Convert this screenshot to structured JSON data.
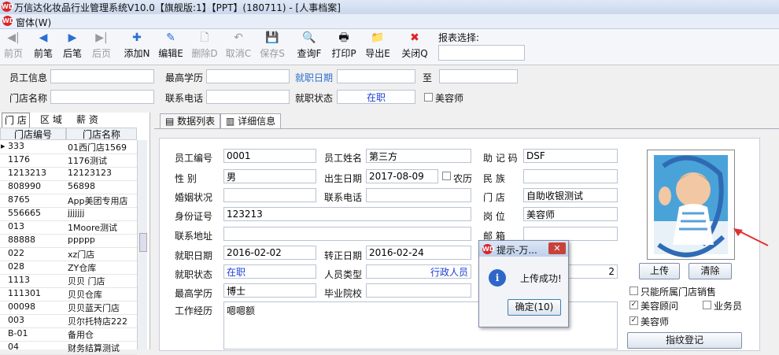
{
  "window": {
    "title": "万信达化妆品行业管理系统V10.0【旗舰版:1】【PPT】(180711) - [人事档案]",
    "menu": "窗体(W)"
  },
  "toolbar": {
    "items": [
      {
        "label": "前页",
        "icon": "◀|"
      },
      {
        "label": "前笔",
        "icon": "◀"
      },
      {
        "label": "后笔",
        "icon": "▶"
      },
      {
        "label": "后页",
        "icon": "▶|"
      },
      {
        "label": "添加N",
        "icon": "✚"
      },
      {
        "label": "编辑E",
        "icon": "✎"
      },
      {
        "label": "删除D",
        "icon": "🗋"
      },
      {
        "label": "取消C",
        "icon": "↶"
      },
      {
        "label": "保存S",
        "icon": "💾"
      },
      {
        "label": "查询F",
        "icon": "🔍"
      },
      {
        "label": "打印P",
        "icon": "🖶"
      },
      {
        "label": "导出E",
        "icon": "📁"
      },
      {
        "label": "关闭Q",
        "icon": "✖"
      }
    ],
    "report_label": "报表选择:"
  },
  "filters": {
    "employee_info": "员工信息",
    "education": "最高学历",
    "join_date": "就职日期",
    "to": "至",
    "store_name": "门店名称",
    "phone": "联系电话",
    "status_label": "就职状态",
    "status_value": "在职",
    "beautician": "美容师"
  },
  "left": {
    "tabs": [
      "门 店",
      "区 域",
      "薪 资"
    ],
    "columns": [
      "门店编号",
      "门店名称"
    ],
    "rows": [
      [
        "333",
        "01西门店1569"
      ],
      [
        "1176",
        "1176测试"
      ],
      [
        "1213213",
        "12123123"
      ],
      [
        "808990",
        "56898"
      ],
      [
        "8765",
        "App美团专用店"
      ],
      [
        "556665",
        "jjjjjjj"
      ],
      [
        "013",
        "1Moore测试"
      ],
      [
        "88888",
        "ppppp"
      ],
      [
        "022",
        "xz门店"
      ],
      [
        "028",
        "ZY仓库"
      ],
      [
        "1113",
        "贝贝 门店"
      ],
      [
        "111301",
        "贝贝仓库"
      ],
      [
        "00098",
        "贝贝蓝天门店"
      ],
      [
        "003",
        "贝尔托特店222"
      ],
      [
        "B-01",
        "备用仓"
      ],
      [
        "04",
        "财务结算测试"
      ]
    ]
  },
  "tabs": [
    "数据列表",
    "详细信息"
  ],
  "detail": {
    "emp_no_label": "员工编号",
    "emp_no": "0001",
    "emp_name_label": "员工姓名",
    "emp_name": "第三方",
    "mnemonic_label": "助 记 码",
    "mnemonic": "DSF",
    "gender_label": "性    别",
    "gender": "男",
    "birth_label": "出生日期",
    "birth": "2017-08-09",
    "lunar": "农历",
    "ethnic_label": "民    族",
    "marital_label": "婚姻状况",
    "phone_label": "联系电话",
    "store_label": "门    店",
    "store": "自助收银测试",
    "id_label": "身份证号",
    "id": "123213",
    "post_label": "岗    位",
    "post": "美容师",
    "address_label": "联系地址",
    "mail_label": "邮    箱",
    "join_label": "就职日期",
    "join": "2016-02-02",
    "regular_label": "转正日期",
    "regular": "2016-02-24",
    "status_label": "就职状态",
    "status": "在职",
    "type_label": "人员类型",
    "type": "行政人员",
    "extra": "2",
    "edu_label": "最高学历",
    "edu": "博士",
    "school_label": "毕业院校",
    "exp_label": "工作经历",
    "exp": "嗯嗯额",
    "upload": "上传",
    "clear": "清除",
    "only_store": "只能所属门店销售",
    "consultant": "美容顾问",
    "sales": "业务员",
    "beautician": "美容师",
    "fingerprint": "指纹登记"
  },
  "dialog": {
    "title": "提示-万...",
    "message": "上传成功!",
    "ok": "确定(10)"
  }
}
